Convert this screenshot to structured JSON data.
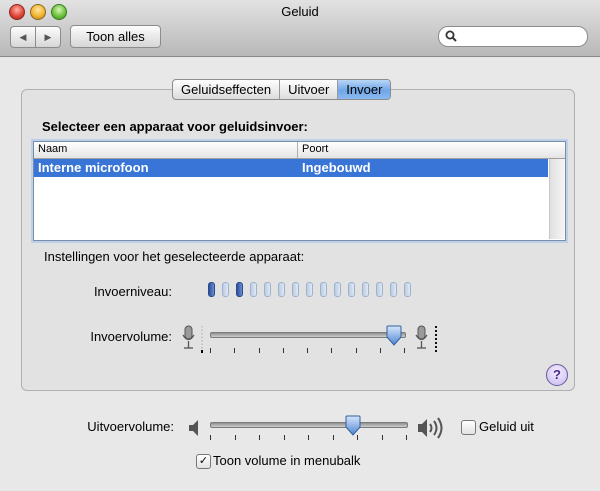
{
  "window": {
    "title": "Geluid"
  },
  "toolbar": {
    "back_glyph": "◀",
    "forward_glyph": "▶",
    "show_all_label": "Toon alles",
    "search_placeholder": ""
  },
  "tabs": [
    {
      "label": "Geluidseffecten",
      "active": false
    },
    {
      "label": "Uitvoer",
      "active": false
    },
    {
      "label": "Invoer",
      "active": true
    }
  ],
  "input": {
    "heading": "Selecteer een apparaat voor geluidsinvoer:",
    "columns": {
      "name": "Naam",
      "port": "Poort"
    },
    "devices": [
      {
        "name": "Interne microfoon",
        "port": "Ingebouwd",
        "selected": true
      }
    ],
    "settings_heading": "Instellingen voor het geselecteerde apparaat:",
    "level_label": "Invoerniveau:",
    "level_segments": 15,
    "level_active_segments": [
      1,
      3
    ],
    "volume_label": "Invoervolume:",
    "volume_value": 0.95,
    "help_glyph": "?"
  },
  "output": {
    "volume_label": "Uitvoervolume:",
    "volume_value": 0.73,
    "mute_label": "Geluid uit",
    "mute_checked": false,
    "menubar_label": "Toon volume in menubalk",
    "menubar_checked": true,
    "check_glyph": "✓"
  },
  "colors": {
    "selection": "#3875d7",
    "active_tab": "#6fa6e6",
    "meter_on": "#2d4f9b"
  }
}
